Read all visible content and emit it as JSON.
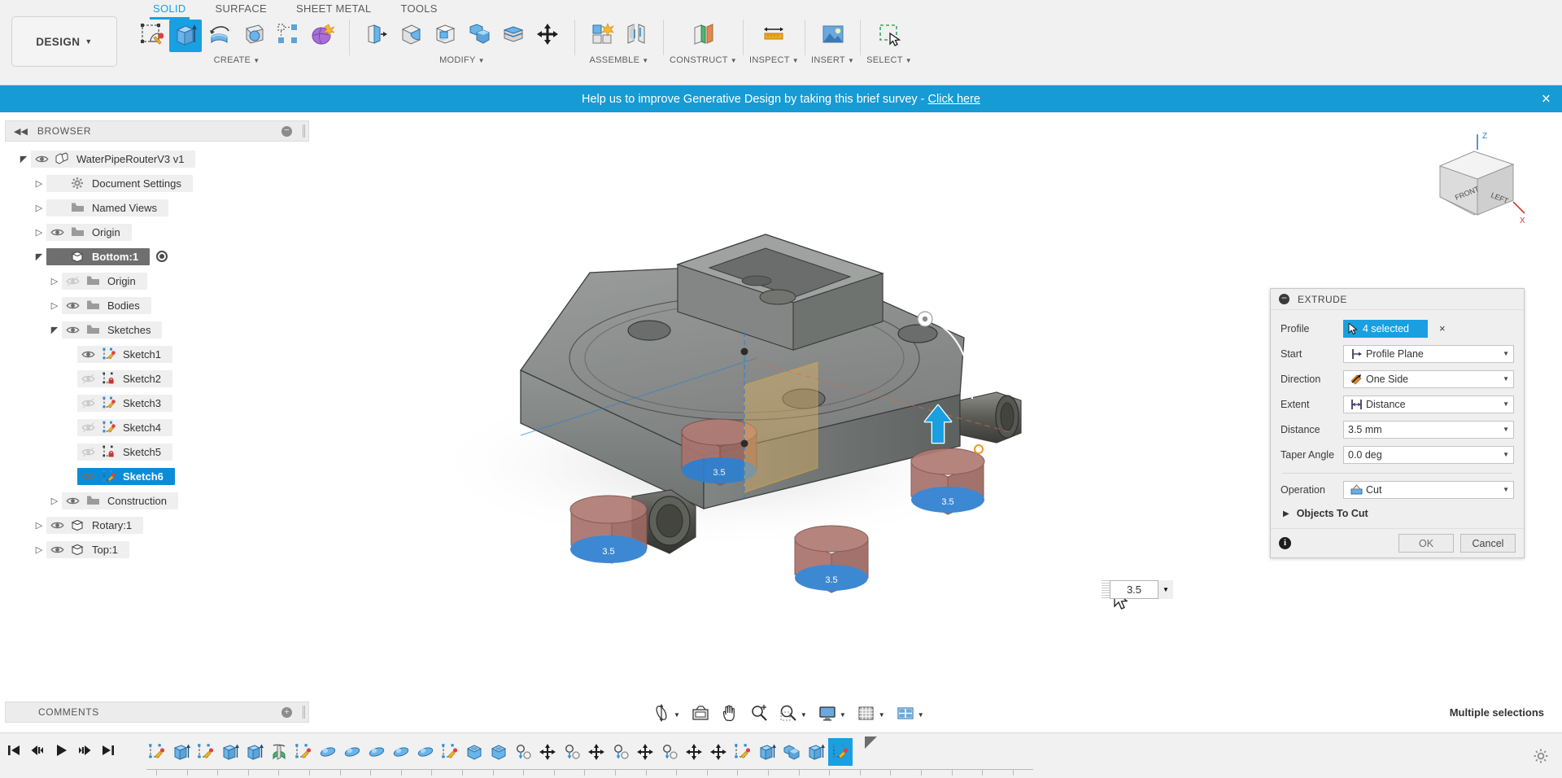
{
  "app": {
    "workspace_label": "DESIGN",
    "status_message": "Multiple selections"
  },
  "ribbon": {
    "tabs": [
      {
        "label": "SOLID",
        "active": true
      },
      {
        "label": "SURFACE",
        "active": false
      },
      {
        "label": "SHEET METAL",
        "active": false
      },
      {
        "label": "TOOLS",
        "active": false
      }
    ],
    "groups": [
      {
        "label": "CREATE",
        "has_caret": true,
        "tools": [
          {
            "name": "create-sketch-icon",
            "title": "Create Sketch",
            "selected": false
          },
          {
            "name": "extrude-icon",
            "title": "Extrude",
            "selected": true
          },
          {
            "name": "revolve-icon",
            "title": "Revolve",
            "selected": false
          },
          {
            "name": "sweep-icon",
            "title": "Sweep",
            "selected": false
          },
          {
            "name": "pattern-icon",
            "title": "Pattern",
            "selected": false
          },
          {
            "name": "form-icon",
            "title": "Create Form",
            "selected": false
          }
        ]
      },
      {
        "label": "MODIFY",
        "has_caret": true,
        "tools": [
          {
            "name": "press-pull-icon",
            "title": "Press Pull",
            "selected": false
          },
          {
            "name": "fillet-icon",
            "title": "Fillet",
            "selected": false
          },
          {
            "name": "shell-icon",
            "title": "Shell",
            "selected": false
          },
          {
            "name": "combine-icon",
            "title": "Combine",
            "selected": false
          },
          {
            "name": "split-face-icon",
            "title": "Split Face",
            "selected": false
          },
          {
            "name": "move-copy-icon",
            "title": "Move/Copy",
            "selected": false
          }
        ]
      },
      {
        "label": "ASSEMBLE",
        "has_caret": true,
        "tools": [
          {
            "name": "new-component-icon",
            "title": "New Component",
            "selected": false
          },
          {
            "name": "joint-icon",
            "title": "Joint",
            "selected": false
          }
        ]
      },
      {
        "label": "CONSTRUCT",
        "has_caret": true,
        "tools": [
          {
            "name": "offset-plane-icon",
            "title": "Offset Plane",
            "selected": false
          }
        ]
      },
      {
        "label": "INSPECT",
        "has_caret": true,
        "tools": [
          {
            "name": "measure-icon",
            "title": "Measure",
            "selected": false
          }
        ]
      },
      {
        "label": "INSERT",
        "has_caret": true,
        "tools": [
          {
            "name": "insert-image-icon",
            "title": "Insert Image",
            "selected": false
          }
        ]
      },
      {
        "label": "SELECT",
        "has_caret": true,
        "tools": [
          {
            "name": "select-window-icon",
            "title": "Select",
            "selected": false
          }
        ]
      }
    ]
  },
  "banner": {
    "text": "Help us to improve Generative Design by taking this brief survey - ",
    "link_text": "Click here",
    "close_label": "×",
    "color": "#169bd5"
  },
  "browser": {
    "title": "BROWSER",
    "collapse_icon": "◀◀",
    "options_icon": "−",
    "tree": [
      {
        "label": "WaterPipeRouterV3 v1",
        "indent": 0,
        "arrow": "expanded",
        "eye": "on",
        "icon": "component-icon",
        "state": "normal"
      },
      {
        "label": "Document Settings",
        "indent": 1,
        "arrow": "collapsed",
        "eye": "none",
        "icon": "gear-icon",
        "state": "normal"
      },
      {
        "label": "Named Views",
        "indent": 1,
        "arrow": "collapsed",
        "eye": "none",
        "icon": "folder-icon",
        "state": "normal"
      },
      {
        "label": "Origin",
        "indent": 1,
        "arrow": "collapsed",
        "eye": "on",
        "icon": "folder-icon",
        "state": "normal"
      },
      {
        "label": "Bottom:1",
        "indent": 1,
        "arrow": "expanded",
        "eye": "on",
        "icon": "body-icon",
        "state": "selected",
        "radio": true
      },
      {
        "label": "Origin",
        "indent": 2,
        "arrow": "collapsed",
        "eye": "off",
        "icon": "folder-icon",
        "state": "normal"
      },
      {
        "label": "Bodies",
        "indent": 2,
        "arrow": "collapsed",
        "eye": "on",
        "icon": "folder-icon",
        "state": "normal"
      },
      {
        "label": "Sketches",
        "indent": 2,
        "arrow": "expanded",
        "eye": "on",
        "icon": "folder-icon",
        "state": "normal"
      },
      {
        "label": "Sketch1",
        "indent": 3,
        "arrow": "none",
        "eye": "on",
        "icon": "sketch-pencil-icon",
        "state": "normal"
      },
      {
        "label": "Sketch2",
        "indent": 3,
        "arrow": "none",
        "eye": "off",
        "icon": "sketch-lock-icon",
        "state": "normal"
      },
      {
        "label": "Sketch3",
        "indent": 3,
        "arrow": "none",
        "eye": "off",
        "icon": "sketch-pencil-icon",
        "state": "normal"
      },
      {
        "label": "Sketch4",
        "indent": 3,
        "arrow": "none",
        "eye": "off",
        "icon": "sketch-pencil-icon",
        "state": "normal"
      },
      {
        "label": "Sketch5",
        "indent": 3,
        "arrow": "none",
        "eye": "off",
        "icon": "sketch-lock-icon",
        "state": "normal"
      },
      {
        "label": "Sketch6",
        "indent": 3,
        "arrow": "none",
        "eye": "on",
        "icon": "sketch-pencil-icon",
        "state": "highlighted"
      },
      {
        "label": "Construction",
        "indent": 2,
        "arrow": "collapsed",
        "eye": "on",
        "icon": "folder-icon",
        "state": "normal"
      },
      {
        "label": "Rotary:1",
        "indent": 1,
        "arrow": "collapsed",
        "eye": "on",
        "icon": "body-icon",
        "state": "normal"
      },
      {
        "label": "Top:1",
        "indent": 1,
        "arrow": "collapsed",
        "eye": "on",
        "icon": "body-icon",
        "state": "normal"
      }
    ]
  },
  "extrude_dialog": {
    "title": "EXTRUDE",
    "profile": {
      "label": "Profile",
      "chip": "4 selected",
      "clear": "×"
    },
    "fields": [
      {
        "label": "Start",
        "value": "Profile Plane",
        "icon": "start-plane-icon",
        "dropdown": true
      },
      {
        "label": "Direction",
        "value": "One Side",
        "icon": "direction-icon",
        "dropdown": true
      },
      {
        "label": "Extent",
        "value": "Distance",
        "icon": "extent-icon",
        "dropdown": true
      },
      {
        "label": "Distance",
        "value": "3.5 mm",
        "icon": "",
        "dropdown": true
      },
      {
        "label": "Taper Angle",
        "value": "0.0 deg",
        "icon": "",
        "dropdown": true
      }
    ],
    "operation": {
      "label": "Operation",
      "value": "Cut",
      "icon": "cut-icon"
    },
    "objects_to_cut": "Objects To Cut",
    "ok_label": "OK",
    "cancel_label": "Cancel",
    "accent_color": "#1a9fe0"
  },
  "canvas_input": {
    "value": "3.5"
  },
  "viewcube": {
    "front_label": "FRONT",
    "left_label": "LEFT",
    "axis_z": "Z",
    "axis_x": "X"
  },
  "comments_panel": {
    "title": "COMMENTS",
    "options_icon": "+"
  },
  "nav_toolbar": [
    {
      "name": "orbit-icon",
      "caret": true
    },
    {
      "name": "look-at-icon",
      "caret": false
    },
    {
      "name": "pan-icon",
      "caret": false
    },
    {
      "name": "zoom-icon",
      "caret": false
    },
    {
      "name": "zoom-window-icon",
      "caret": true
    },
    {
      "name": "display-settings-icon",
      "caret": true
    },
    {
      "name": "grid-snaps-icon",
      "caret": true
    },
    {
      "name": "viewports-icon",
      "caret": true
    }
  ],
  "timeline": {
    "playback": [
      {
        "name": "go-to-beginning-icon"
      },
      {
        "name": "step-back-icon"
      },
      {
        "name": "play-icon"
      },
      {
        "name": "step-forward-icon"
      },
      {
        "name": "go-to-end-icon"
      }
    ],
    "features": [
      {
        "name": "sketch-feature-icon",
        "selected": false
      },
      {
        "name": "extrude-feature-icon",
        "selected": false
      },
      {
        "name": "sketch-feature-icon",
        "selected": false
      },
      {
        "name": "extrude-feature-icon",
        "selected": false
      },
      {
        "name": "extrude-feature-icon",
        "selected": false
      },
      {
        "name": "revolve-feature-icon",
        "selected": false
      },
      {
        "name": "sketch-feature-icon",
        "selected": false
      },
      {
        "name": "fillet-feature-icon",
        "selected": false
      },
      {
        "name": "fillet-feature-icon",
        "selected": false
      },
      {
        "name": "fillet-feature-icon",
        "selected": false
      },
      {
        "name": "fillet-feature-icon",
        "selected": false
      },
      {
        "name": "fillet-feature-icon",
        "selected": false
      },
      {
        "name": "sketch-feature-icon",
        "selected": false
      },
      {
        "name": "shell-feature-icon",
        "selected": false
      },
      {
        "name": "shell-feature-icon",
        "selected": false
      },
      {
        "name": "joint-feature-icon",
        "selected": false
      },
      {
        "name": "move-feature-icon",
        "selected": false
      },
      {
        "name": "joint-feature-icon",
        "selected": false
      },
      {
        "name": "move-feature-icon",
        "selected": false
      },
      {
        "name": "joint-feature-icon",
        "selected": false
      },
      {
        "name": "move-feature-icon",
        "selected": false
      },
      {
        "name": "joint-feature-icon",
        "selected": false
      },
      {
        "name": "move-feature-icon",
        "selected": false
      },
      {
        "name": "move-feature-icon",
        "selected": false
      },
      {
        "name": "sketch-feature-icon",
        "selected": false
      },
      {
        "name": "extrude-feature-icon",
        "selected": false
      },
      {
        "name": "combine-feature-icon",
        "selected": false
      },
      {
        "name": "extrude-feature-icon",
        "selected": false
      },
      {
        "name": "sketch-feature-icon",
        "selected": true
      }
    ]
  }
}
